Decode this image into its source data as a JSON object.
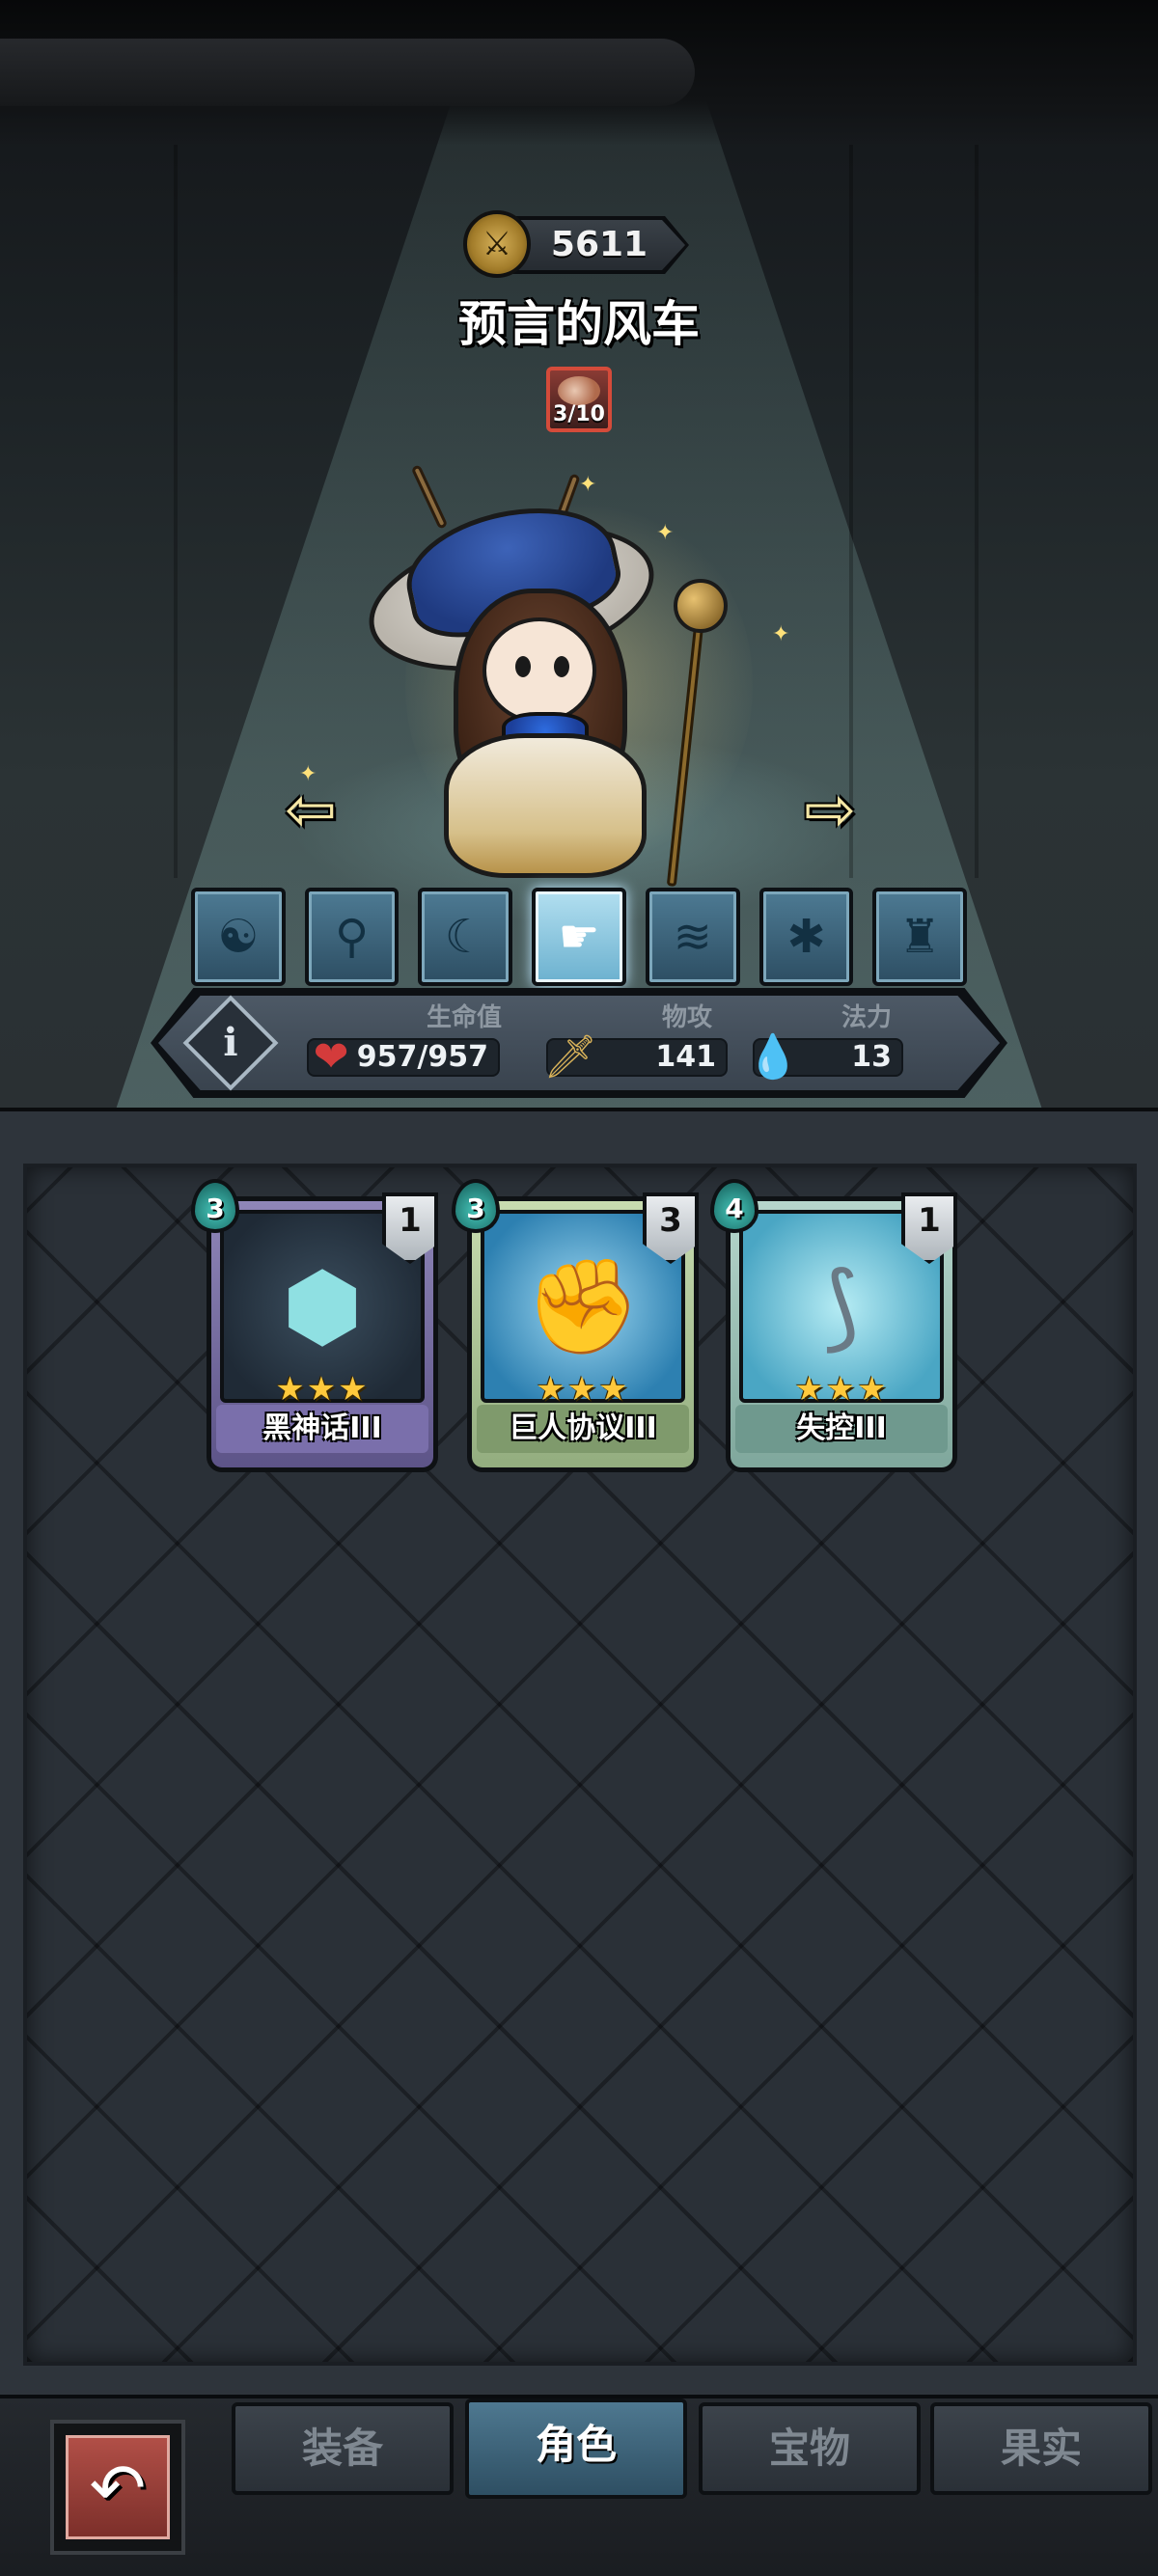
{
  "hero": {
    "power": "5611",
    "name": "预言的风车",
    "shards": "3/10"
  },
  "skills": [
    {
      "icon": "swirl-mask-icon",
      "active": false
    },
    {
      "icon": "wand-icon",
      "active": false
    },
    {
      "icon": "crescent-icon",
      "active": false
    },
    {
      "icon": "pointing-hand-icon",
      "active": true
    },
    {
      "icon": "spiral-paper-icon",
      "active": false
    },
    {
      "icon": "beetle-icon",
      "active": false
    },
    {
      "icon": "muscle-torso-icon",
      "active": false
    }
  ],
  "stats": {
    "hp_label": "生命值",
    "hp_value": "957/957",
    "atk_label": "物攻",
    "atk_value": "141",
    "mp_label": "法力",
    "mp_value": "13"
  },
  "cards": [
    {
      "name": "黑神话III",
      "cost": "3",
      "level": "1",
      "stars": "★★★",
      "theme": "purple"
    },
    {
      "name": "巨人协议III",
      "cost": "3",
      "level": "3",
      "stars": "★★★",
      "theme": "green"
    },
    {
      "name": "失控III",
      "cost": "4",
      "level": "1",
      "stars": "★★★",
      "theme": "teal"
    }
  ],
  "nav": {
    "back_icon": "return-arrow-icon",
    "tabs": [
      {
        "label": "装备",
        "active": false
      },
      {
        "label": "角色",
        "active": true
      },
      {
        "label": "宝物",
        "active": false
      },
      {
        "label": "果实",
        "active": false
      }
    ]
  },
  "colors": {
    "accent_active_tab": "#4e7890",
    "back_button": "#b14f47",
    "hp_icon": "#d43b3b",
    "mana_icon": "#45c4b8"
  }
}
